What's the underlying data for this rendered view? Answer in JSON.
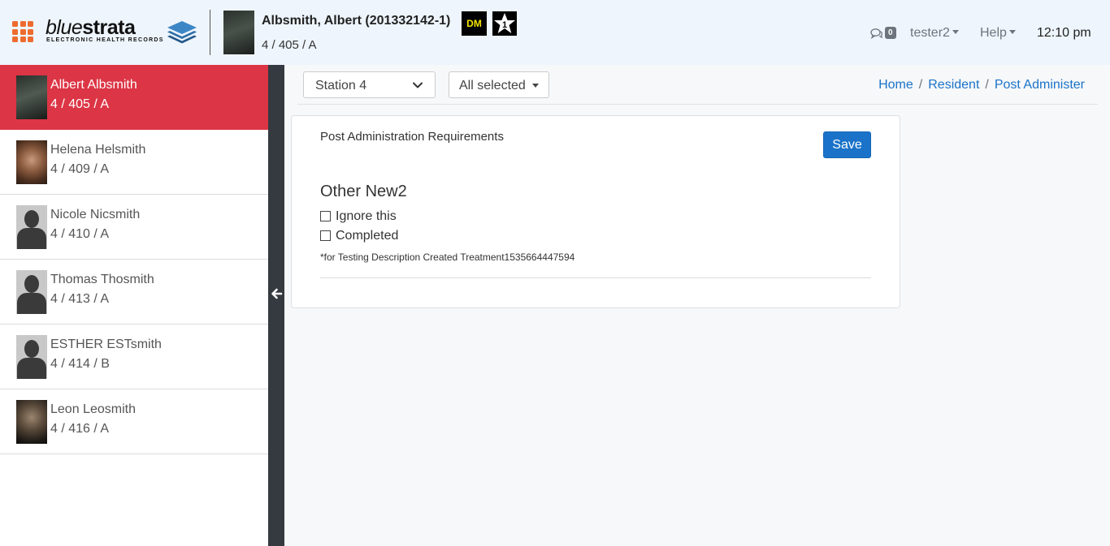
{
  "header": {
    "logo": {
      "brand_light": "blue",
      "brand_bold": "strata",
      "tagline": "ELECTRONIC HEALTH RECORDS"
    },
    "patient": {
      "name": "Albsmith, Albert (201332142-1)",
      "location": "4 / 405 / A",
      "badge_dm": "DM"
    },
    "messages_count": "0",
    "user": "tester2",
    "help": "Help",
    "time": "12:10 pm"
  },
  "residents": [
    {
      "name": "Albert Albsmith",
      "location": "4 / 405 / A",
      "active": true,
      "photo": "photo"
    },
    {
      "name": "Helena Helsmith",
      "location": "4 / 409 / A",
      "active": false,
      "photo": "photo"
    },
    {
      "name": "Nicole Nicsmith",
      "location": "4 / 410 / A",
      "active": false,
      "photo": "silhouette"
    },
    {
      "name": "Thomas Thosmith",
      "location": "4 / 413 / A",
      "active": false,
      "photo": "silhouette"
    },
    {
      "name": "ESTHER ESTsmith",
      "location": "4 / 414 / B",
      "active": false,
      "photo": "silhouette"
    },
    {
      "name": "Leon Leosmith",
      "location": "4 / 416 / A",
      "active": false,
      "photo": "photo"
    }
  ],
  "toolbar": {
    "station": "Station 4",
    "filter": "All selected",
    "breadcrumb": [
      "Home",
      "Resident",
      "Post Administer"
    ]
  },
  "card": {
    "title": "Post Administration Requirements",
    "save_label": "Save",
    "section_title": "Other New2",
    "checkboxes": [
      {
        "label": "Ignore this",
        "checked": false
      },
      {
        "label": "Completed",
        "checked": false
      }
    ],
    "note": "*for Testing Description Created Treatment1535664447594"
  },
  "colors": {
    "accent": "#1a73c9",
    "active_row": "#dc3545",
    "header_bg": "#eef5fc",
    "apps_icon": "#ee6b2f",
    "toggle_bar": "#343a40"
  }
}
